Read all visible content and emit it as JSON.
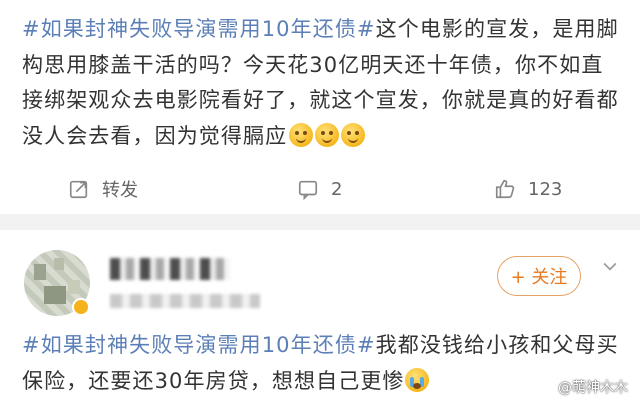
{
  "post1": {
    "topic": "#如果封神失败导演需用10年还债#",
    "text": "这个电影的宣发，是用脚构思用膝盖干活的吗？今天花30亿明天还十年债，你不如直接绑架观众去电影院看好了，就这个宣发，你就是真的好看都没人会去看，因为觉得膈应",
    "emojis": [
      "laugh-cry-emoji",
      "laugh-cry-emoji",
      "laugh-cry-emoji"
    ]
  },
  "actions": {
    "repost_label": "转发",
    "comment_count": "2",
    "like_count": "123"
  },
  "post2": {
    "follow_label": "+ 关注",
    "topic": "#如果封神失败导演需用10年还债#",
    "text": "我都没钱给小孩和父母买保险，还要还30年房贷，想想自己更惨"
  },
  "watermark": {
    "text": "@萌神木木"
  }
}
